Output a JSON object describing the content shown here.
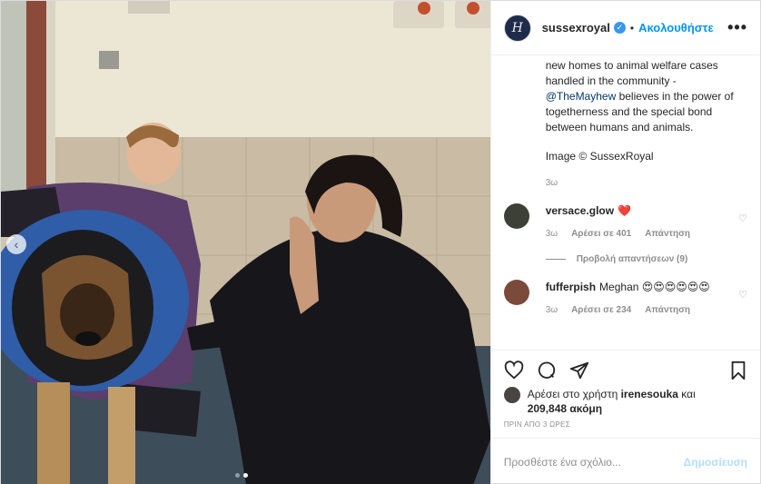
{
  "header": {
    "username": "sussexroyal",
    "avatar_monogram": "H",
    "follow_label": "Ακολουθήστε",
    "separator": "•",
    "more_label": "•••"
  },
  "caption": {
    "lines_1": "new homes to animal welfare cases handled in the community -",
    "mention": "@TheMayhew",
    "lines_2": " believes in the power of togetherness and the special bond between humans and animals.",
    "credit": "Image © SussexRoyal",
    "time": "3ω"
  },
  "comments": [
    {
      "user": "versace.glow",
      "text": "❤️",
      "time": "3ω",
      "likes": "Αρέσει σε 401",
      "reply": "Απάντηση",
      "view_replies": "Προβολή απαντήσεων (9)",
      "avatar_color": "#3c4036"
    },
    {
      "user": "fufferpish",
      "text": "Meghan 😍😍😍😍😍😍",
      "time": "3ω",
      "likes": "Αρέσει σε 234",
      "reply": "Απάντηση",
      "avatar_color": "#7a4a3a"
    }
  ],
  "likes": {
    "prefix": "Αρέσει στο χρήστη ",
    "user": "irenesouka",
    "middle": " και",
    "count": "209,848 ακόμη"
  },
  "timestamp": "ΠΡΙΝ ΑΠΟ 3 ΩΡΕΣ",
  "add_comment": {
    "placeholder": "Προσθέστε ένα σχόλιο...",
    "post_label": "Δημοσίευση"
  },
  "colors": {
    "accent": "#0095f6",
    "verified": "#3897f0",
    "heart_red": "#ed4956"
  },
  "carousel": {
    "current": 2,
    "total": 2
  }
}
